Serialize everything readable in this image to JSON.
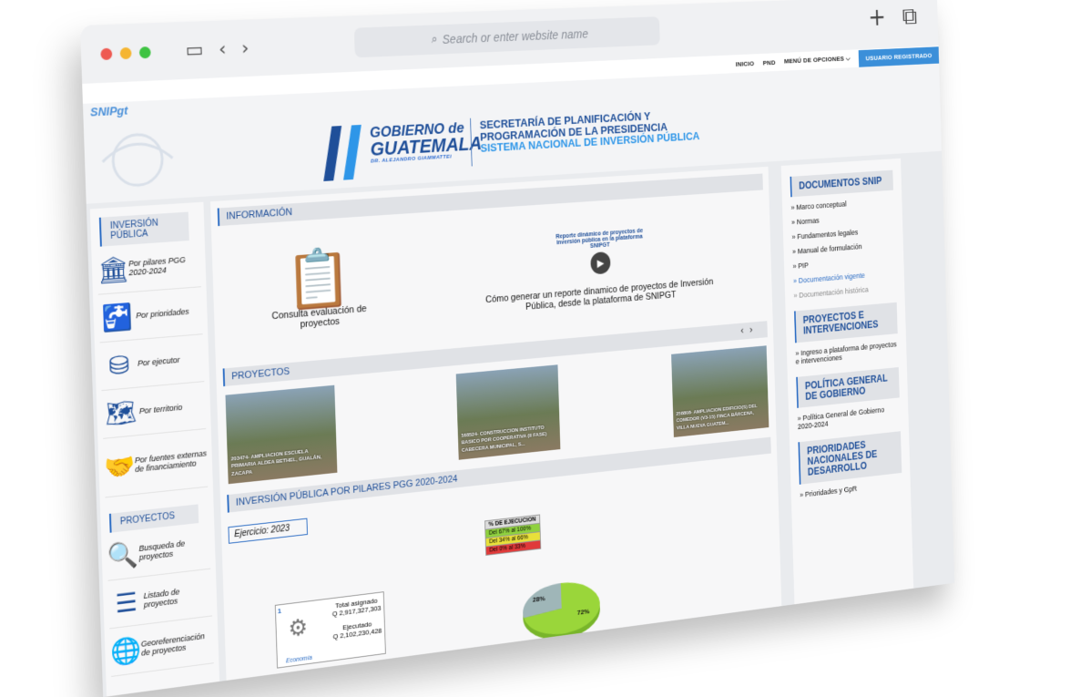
{
  "browser": {
    "dot_colors": [
      "#ee5a52",
      "#f5b531",
      "#3ec342"
    ],
    "search_placeholder": "Search or enter website name"
  },
  "navbar": {
    "items": [
      "INICIO",
      "PND",
      "MENÚ DE OPCIONES ⌵"
    ],
    "user_label": "USUARIO REGISTRADO"
  },
  "header": {
    "site_name": "SNIPgt",
    "gob_line1": "GOBIERNO de",
    "gob_line2": "GUATEMALA",
    "gob_line3": "DR. ALEJANDRO GIAMMATTEI",
    "seg_line1": "SECRETARÍA DE PLANIFICACIÓN Y",
    "seg_line2": "PROGRAMACIÓN DE LA PRESIDENCIA",
    "seg_line3": "SISTEMA NACIONAL DE INVERSIÓN PÚBLICA"
  },
  "left": {
    "inv_title": "INVERSIÓN PÚBLICA",
    "inv_items": [
      {
        "label": "Por pilares PGG 2020-2024",
        "icon": "bank-icon"
      },
      {
        "label": "Por prioridades",
        "icon": "faucet-icon"
      },
      {
        "label": "Por ejecutor",
        "icon": "coins-icon"
      },
      {
        "label": "Por territorio",
        "icon": "map-icon"
      },
      {
        "label": "Por fuentes externas de financiamiento",
        "icon": "handshake-icon"
      }
    ],
    "proj_title": "PROYECTOS",
    "proj_items": [
      {
        "label": "Busqueda de proyectos",
        "icon": "magnifier-icon"
      },
      {
        "label": "Listado de proyectos",
        "icon": "list-icon"
      },
      {
        "label": "Georeferenciación de proyectos",
        "icon": "globe-icon"
      }
    ]
  },
  "main": {
    "info_title": "INFORMACIÓN",
    "consulta_caption": "Consulta evaluación de proyectos",
    "video_overlay": "Reporte dinámico de proyectos de inversión pública en la plataforma SNIPGT",
    "video_caption": "Cómo generar un reporte dinamico de proyectos de Inversión Pública, desde la plataforma de SNIPGT",
    "proyectos_title": "PROYECTOS",
    "projects": [
      {
        "caption": "203474- AMPLIACION ESCUELA PRIMARIA ALDEA BETHEL, GUALÁN, ZACAPA"
      },
      {
        "caption": "168524- CONSTRUCCION INSTITUTO BASICO POR COOPERATIVA (II FASE) CABECERA MUNICIPAL, S..."
      },
      {
        "caption": "258808- AMPLIACION EDIFICIO(S) DEL COMEDOR (V3-15) FINCA BÁRCENA, VILLA NUEVA GUATEM..."
      }
    ],
    "pilares_title": "INVERSIÓN PÚBLICA POR PILARES PGG 2020-2024",
    "ejercicio": "Ejercicio: 2023",
    "legend_title": "% DE EJECUCION",
    "legend": [
      {
        "label": "Del 67% al 100%",
        "color": "#8fd13f"
      },
      {
        "label": "Del 34% al 66%",
        "color": "#e8e03a"
      },
      {
        "label": "Del 0% al 33%",
        "color": "#e03a3a"
      }
    ],
    "pilar_num": "1",
    "pilar_name": "Economía",
    "total_label": "Total asignado",
    "total_value": "Q 2,917,327,303",
    "ejecutado_label": "Ejecutado",
    "ejecutado_value": "Q 2,102,230,428",
    "pie_slices": [
      {
        "label": "72%",
        "value": 72,
        "color": "#9ad63a"
      },
      {
        "label": "28%",
        "value": 28,
        "color": "#9fb6b8"
      }
    ]
  },
  "right": {
    "docs_title": "DOCUMENTOS SNIP",
    "docs": [
      {
        "label": "» Marco conceptual",
        "style": "normal"
      },
      {
        "label": "» Normas",
        "style": "normal"
      },
      {
        "label": "» Fundamentos legales",
        "style": "normal"
      },
      {
        "label": "» Manual de formulación",
        "style": "normal"
      },
      {
        "label": "» PIP",
        "style": "normal"
      },
      {
        "label": "» Documentación vigente",
        "style": "blue"
      },
      {
        "label": "» Documentación histórica",
        "style": "grey"
      }
    ],
    "proy_title": "PROYECTOS E INTERVENCIONES",
    "proy_link": "» Ingreso a plataforma de proyectos e intervenciones",
    "politica_title": "POLÍTICA GENERAL DE GOBIERNO",
    "politica_link": "» Política General de Gobierno 2020-2024",
    "prior_title": "PRIORIDADES NACIONALES DE DESARROLLO",
    "prior_link": "» Prioridades y GpR"
  }
}
